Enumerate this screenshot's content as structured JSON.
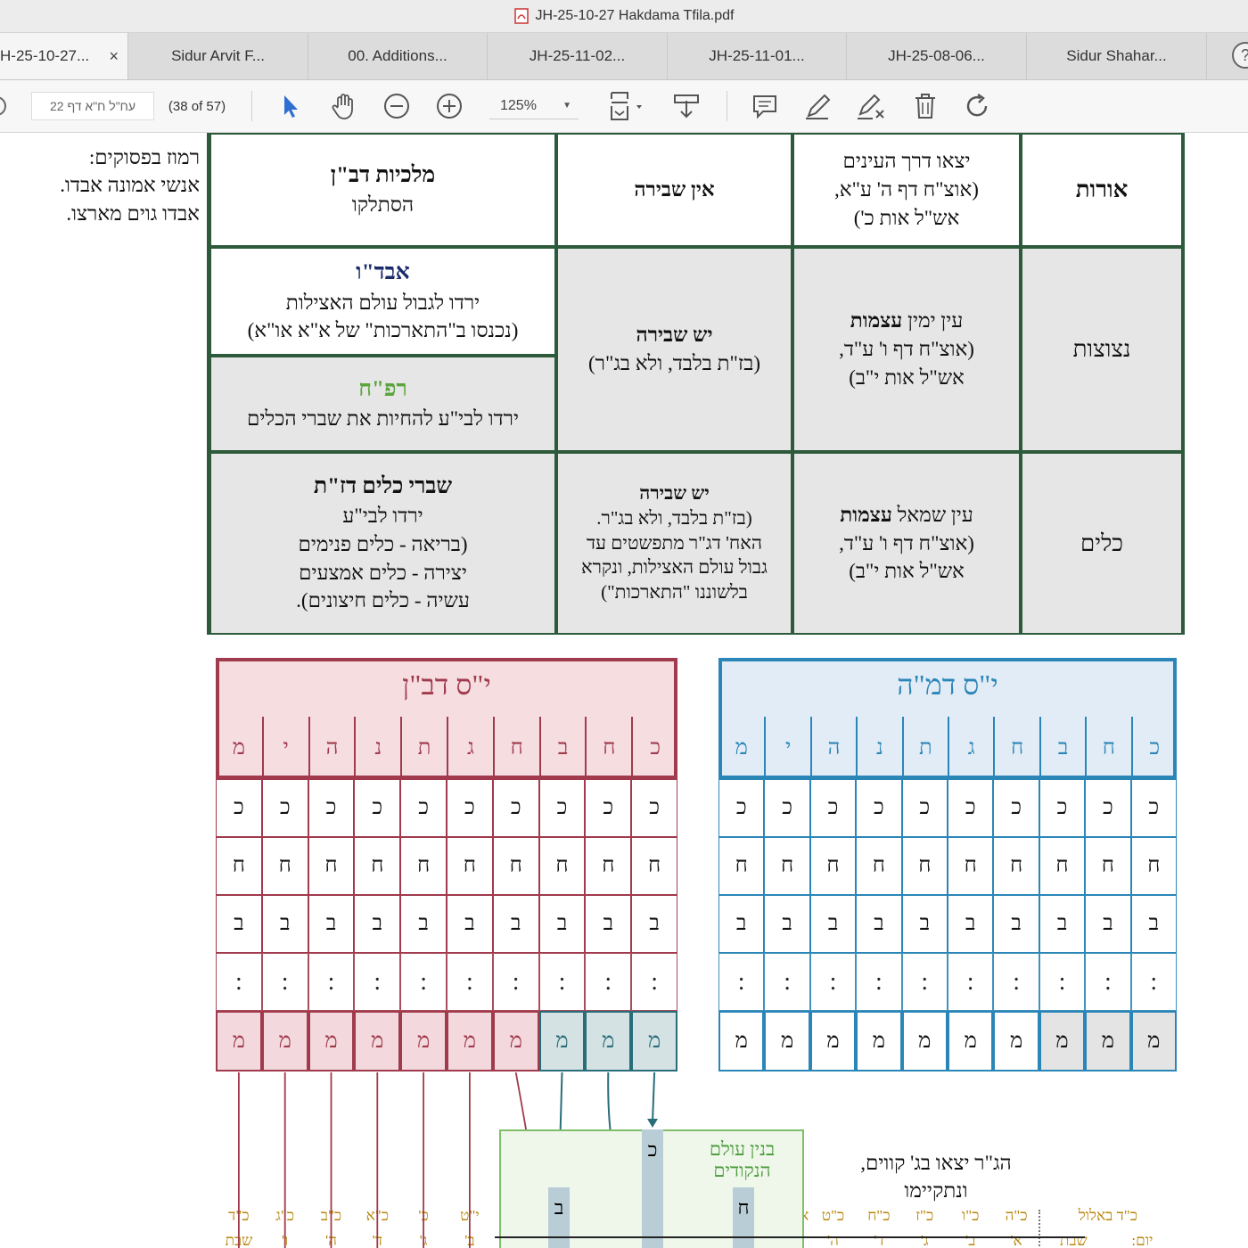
{
  "window": {
    "title": "JH-25-10-27 Hakdama Tfila.pdf"
  },
  "tabs": [
    {
      "label": "H-25-10-27...",
      "active": true,
      "close": "×"
    },
    {
      "label": "Sidur Arvit F..."
    },
    {
      "label": "00. Additions..."
    },
    {
      "label": "JH-25-11-02..."
    },
    {
      "label": "JH-25-11-01..."
    },
    {
      "label": "JH-25-08-06..."
    },
    {
      "label": "Sidur Shahar..."
    }
  ],
  "help_label": "?",
  "toolbar": {
    "page_field": "עח\"ל ח\"א דף 22",
    "page_count": "(38 of 57)",
    "zoom": "125%",
    "icons": [
      "select-arrow-icon",
      "hand-icon",
      "zoom-out-icon",
      "zoom-in-icon",
      "page-fit-icon",
      "download-icon",
      "comment-icon",
      "pen-icon",
      "highlighter-icon",
      "trash-icon",
      "rotate-icon"
    ]
  },
  "side_note": [
    "רמוז בפסוקים:",
    "אנשי אמונה אבדו.",
    "אבדו גוים מארצו."
  ],
  "table": {
    "row1": {
      "header": "אורות",
      "col1": [
        "יצאו דרך העינים",
        "(אוצ\"ח דף ה' ע\"א,",
        "אש\"ל אות כ')"
      ],
      "col2": "אין שבירה",
      "col3": [
        "מלכיות דב\"ן",
        "הסתלקו"
      ]
    },
    "row2": {
      "header": "נקודים",
      "header_display": "נצוצות",
      "col1_bold": "עצמות",
      "col1": [
        "עין ימין",
        "(אוצ\"ח דף ו' ע\"ד,",
        "אש\"ל אות י\"ב)"
      ],
      "col2_title": "יש שבירה",
      "col2_sub": "(בז\"ת בלבד, ולא בג\"ר)",
      "col3a_title": "אבד\"ו",
      "col3a": [
        "ירדו לגבול עולם האצילות",
        "(נכנסו ב\"התארכות\" של א\"א או\"א)"
      ],
      "col3b_title": "רפ\"ח",
      "col3b": "ירדו לבי\"ע להחיות את שברי הכלים"
    },
    "row3": {
      "header": "כלים",
      "col1_bold": "עצמות",
      "col1": [
        "עין שמאל",
        "(אוצ\"ח דף ו' ע\"ד,",
        "אש\"ל אות י\"ב)"
      ],
      "col2_title": "יש שבירה",
      "col2": [
        "(בז\"ת בלבד, ולא בג\"ר.",
        "האח' דג\"ר מתפשטים עד",
        "גבול עולם האצילות, ונקרא",
        "בלשוננו \"התארכות\")"
      ],
      "col3_title": "שברי כלים דז\"ת",
      "col3_sub": "ירדו לבי\"ע",
      "col3": [
        "(בריאה - כלים פנימים",
        "יצירה - כלים אמצעים",
        "עשיה - כלים חיצונים)."
      ]
    }
  },
  "grid_left": {
    "title": "י\"ס דב\"ן",
    "headers": [
      "מ",
      "י",
      "ה",
      "נ",
      "ת",
      "ג",
      "ח",
      "ב",
      "ח",
      "כ"
    ],
    "rows": [
      "כ",
      "ח",
      "ב",
      ":"
    ],
    "bottom": "מ",
    "labels_top": [
      "כ\"ד",
      "כ\"ג",
      "כ\"ב",
      "כ\"א",
      "כ'",
      "י\"ט",
      "י\"ח",
      "י\"ז באלול"
    ],
    "labels_bottom": [
      "שבת",
      "ו'",
      "ה'",
      "ד'",
      "ג'",
      "ב'",
      "א'",
      "שבת",
      "יום:"
    ]
  },
  "grid_right": {
    "title": "י\"ס דמ\"ה",
    "headers": [
      "מ",
      "י",
      "ה",
      "נ",
      "ת",
      "ג",
      "ח",
      "ב",
      "ח",
      "כ"
    ],
    "rows": [
      "כ",
      "ח",
      "ב",
      ":"
    ],
    "bottom": "מ",
    "labels_top": [
      "ב'",
      "א'תשרי",
      "כ\"ט",
      "כ\"ח",
      "כ\"ז",
      "כ\"ו",
      "כ\"ה",
      "כ\"ד באלול"
    ],
    "labels_bottom": [
      "שבת",
      "ו'",
      "ה'",
      "ד'",
      "ג'",
      "ב'",
      "א'",
      "שבת",
      "יום:"
    ]
  },
  "diagram": {
    "box_title": [
      "בנין עולם",
      "הנקודים"
    ],
    "bars": [
      "ב",
      "כ",
      "ח"
    ],
    "note": [
      "הג\"ר יצאו בג' קווים,",
      "ונתקיימו"
    ]
  },
  "colors": {
    "left_grid": "#a03a4c",
    "right_grid": "#2b86b8",
    "table_border": "#2c5a3a",
    "label": "#b8860b"
  }
}
